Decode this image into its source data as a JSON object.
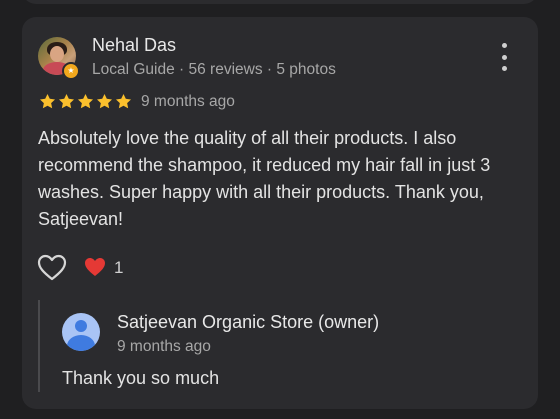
{
  "review": {
    "name": "Nehal Das",
    "meta": "Local Guide · 56 reviews · 5 photos",
    "rating": 5,
    "rating_max": 5,
    "date": "9 months ago",
    "text": "Absolutely love the quality of all their products. I also recommend the shampoo, it reduced my hair fall in just 3 washes. Super happy with all their products. Thank you, Satjeevan!",
    "reaction_count": "1"
  },
  "reply": {
    "name": "Satjeevan Organic Store (owner)",
    "date": "9 months ago",
    "text": "Thank you so much"
  },
  "colors": {
    "background": "#1f1f21",
    "card": "#2b2b2e",
    "star": "#fbc02d",
    "heart": "#e53935",
    "owner_avatar": "#a9c4f5"
  },
  "icons": {
    "more": "more-vert-icon",
    "like": "heart-outline-icon",
    "reaction": "red-heart-emoji-icon",
    "star": "star-icon"
  }
}
